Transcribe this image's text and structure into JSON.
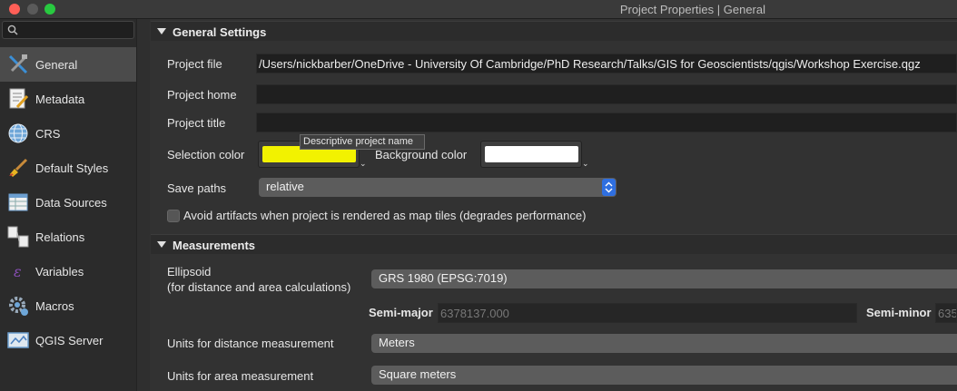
{
  "window": {
    "title": "Project Properties | General"
  },
  "sidebar": {
    "search_placeholder": "",
    "items": [
      {
        "label": "General",
        "icon": "general-tools-icon",
        "active": true
      },
      {
        "label": "Metadata",
        "icon": "metadata-icon",
        "active": false
      },
      {
        "label": "CRS",
        "icon": "crs-globe-icon",
        "active": false
      },
      {
        "label": "Default Styles",
        "icon": "default-styles-brush-icon",
        "active": false
      },
      {
        "label": "Data Sources",
        "icon": "data-sources-table-icon",
        "active": false
      },
      {
        "label": "Relations",
        "icon": "relations-icon",
        "active": false
      },
      {
        "label": "Variables",
        "icon": "variables-icon",
        "active": false
      },
      {
        "label": "Macros",
        "icon": "macros-gear-icon",
        "active": false
      },
      {
        "label": "QGIS Server",
        "icon": "qgis-server-icon",
        "active": false
      }
    ]
  },
  "general": {
    "section_title": "General Settings",
    "project_file_label": "Project file",
    "project_file_value": "/Users/nickbarber/OneDrive - University Of Cambridge/PhD Research/Talks/GIS for Geoscientists/qgis/Workshop Exercise.qgz",
    "project_home_label": "Project home",
    "project_home_value": "",
    "project_title_label": "Project title",
    "project_title_value": "",
    "tooltip": "Descriptive project name",
    "selection_color_label": "Selection color",
    "selection_color": "#f2f200",
    "background_color_label": "Background color",
    "background_color": "#ffffff",
    "save_paths_label": "Save paths",
    "save_paths_value": "relative",
    "avoid_artifacts_label": "Avoid artifacts when project is rendered as map tiles (degrades performance)",
    "avoid_artifacts_checked": false
  },
  "measurements": {
    "section_title": "Measurements",
    "ellipsoid_label": "Ellipsoid",
    "ellipsoid_sublabel": "(for distance and area calculations)",
    "ellipsoid_value": "GRS 1980 (EPSG:7019)",
    "semi_major_label": "Semi-major",
    "semi_major_value": "6378137.000",
    "semi_minor_label": "Semi-minor",
    "semi_minor_value": "635",
    "distance_units_label": "Units for distance measurement",
    "distance_units_value": "Meters",
    "area_units_label": "Units for area measurement",
    "area_units_value": "Square meters"
  },
  "colors": {
    "accent": "#2f6fe0",
    "sidebar_active": "#4b4b4b"
  }
}
